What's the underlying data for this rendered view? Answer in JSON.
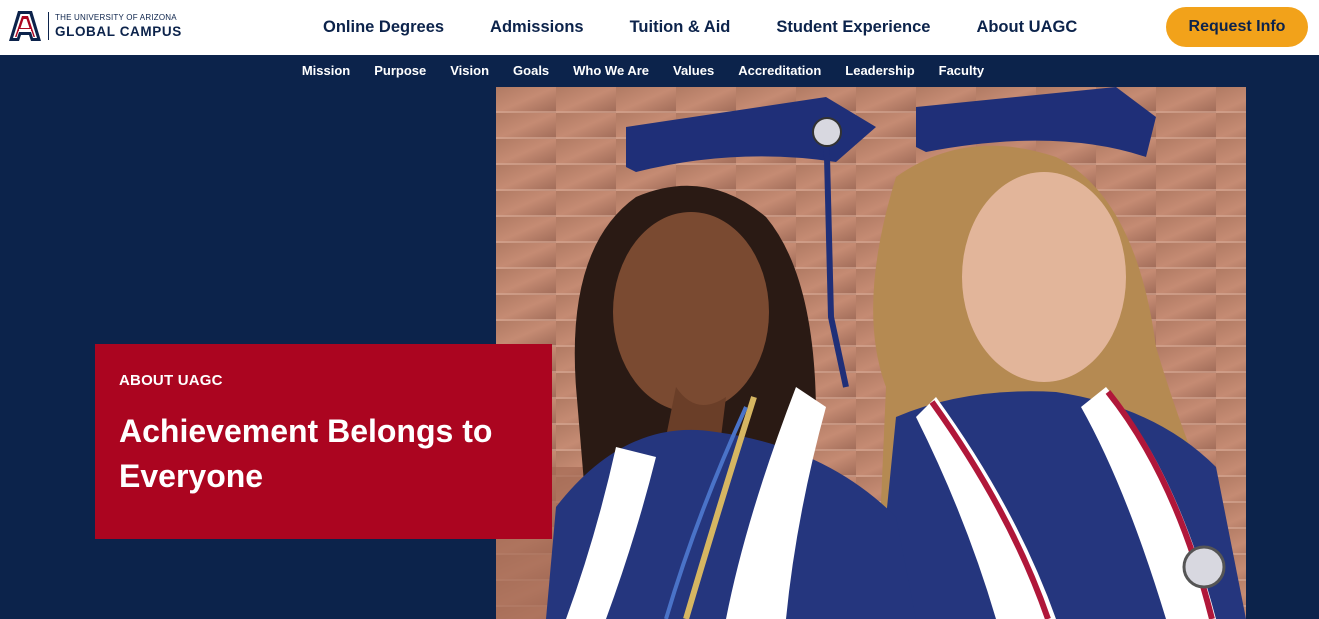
{
  "brand": {
    "logo_small": "THE UNIVERSITY OF ARIZONA",
    "logo_big": "GLOBAL CAMPUS",
    "colors": {
      "navy": "#0c234b",
      "red": "#ab0520",
      "gold": "#f2a21a"
    }
  },
  "main_nav": {
    "items": [
      {
        "label": "Online Degrees"
      },
      {
        "label": "Admissions"
      },
      {
        "label": "Tuition & Aid"
      },
      {
        "label": "Student Experience"
      },
      {
        "label": "About UAGC"
      }
    ]
  },
  "header": {
    "cta_label": "Request Info"
  },
  "sub_nav": {
    "items": [
      {
        "label": "Mission"
      },
      {
        "label": "Purpose"
      },
      {
        "label": "Vision"
      },
      {
        "label": "Goals"
      },
      {
        "label": "Who We Are"
      },
      {
        "label": "Values"
      },
      {
        "label": "Accreditation"
      },
      {
        "label": "Leadership"
      },
      {
        "label": "Faculty"
      }
    ]
  },
  "hero": {
    "eyebrow": "ABOUT UAGC",
    "headline": "Achievement Belongs to Everyone",
    "image_subject": "two-graduates-photo"
  }
}
